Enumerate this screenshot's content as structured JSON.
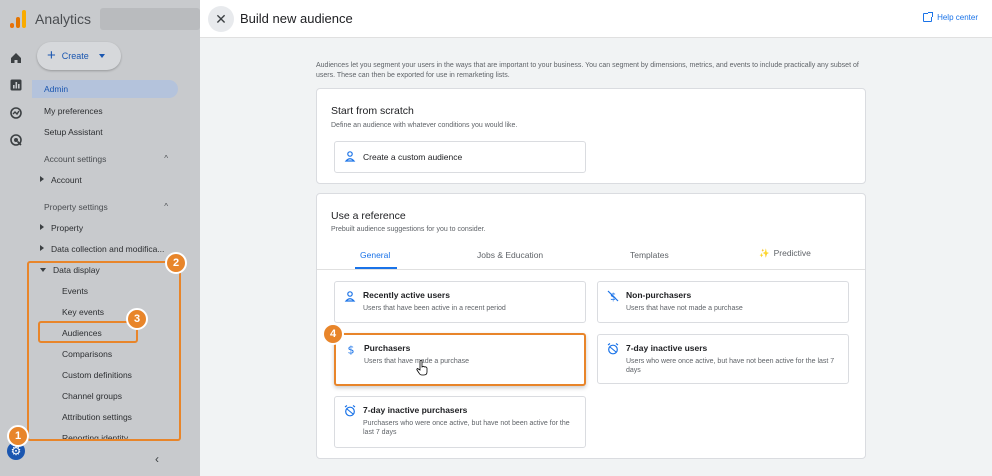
{
  "app": {
    "title": "Analytics",
    "create_label": "Create",
    "nav": {
      "admin": "Admin",
      "my_preferences": "My preferences",
      "setup_assistant": "Setup Assistant",
      "account_settings": "Account settings",
      "account": "Account",
      "property_settings": "Property settings",
      "property": "Property",
      "data_collection": "Data collection and modifica...",
      "data_display": "Data display",
      "events": "Events",
      "key_events": "Key events",
      "audiences": "Audiences",
      "comparisons": "Comparisons",
      "custom_definitions": "Custom definitions",
      "channel_groups": "Channel groups",
      "attribution_settings": "Attribution settings",
      "reporting_identity": "Reporting identity"
    }
  },
  "badges": {
    "b1": "1",
    "b2": "2",
    "b3": "3",
    "b4": "4"
  },
  "panel": {
    "title": "Build new audience",
    "help_label": "Help center",
    "intro": "Audiences let you segment your users in the ways that are important to your business. You can segment by dimensions, metrics, and events to include practically any subset of users. These can then be exported for use in remarketing lists.",
    "scratch": {
      "title": "Start from scratch",
      "subtitle": "Define an audience with whatever conditions you would like.",
      "custom_label": "Create a custom audience"
    },
    "reference": {
      "title": "Use a reference",
      "subtitle": "Prebuilt audience suggestions for you to consider.",
      "tabs": [
        "General",
        "Jobs & Education",
        "Templates",
        "Predictive"
      ],
      "options": [
        {
          "title": "Recently active users",
          "desc": "Users that have been active in a recent period"
        },
        {
          "title": "Non-purchasers",
          "desc": "Users that have not made a purchase"
        },
        {
          "title": "Purchasers",
          "desc": "Users that have made a purchase"
        },
        {
          "title": "7-day inactive users",
          "desc": "Users who were once active, but have not been active for the last 7 days"
        },
        {
          "title": "7-day inactive purchasers",
          "desc": "Purchasers who were once active, but have not been active for the last 7 days"
        }
      ]
    }
  },
  "colors": {
    "highlight": "#e8852a",
    "accent": "#1a73e8"
  }
}
